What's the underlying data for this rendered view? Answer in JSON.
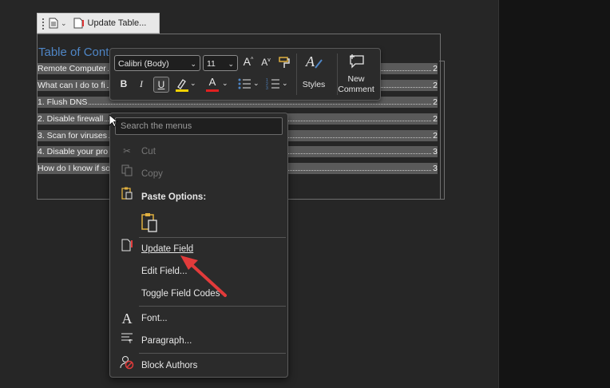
{
  "field_bar": {
    "update_label": "Update Table..."
  },
  "toc": {
    "title": "Table of Cont",
    "entries": [
      {
        "text": "Remote Computer",
        "page": "2"
      },
      {
        "text": "What can I do to fi",
        "page": "2"
      },
      {
        "text": "1. Flush DNS",
        "page": "2"
      },
      {
        "text": "2. Disable firewall",
        "page": "2"
      },
      {
        "text": "3. Scan for viruses",
        "page": "2"
      },
      {
        "text": "4. Disable your pro",
        "page": "3"
      },
      {
        "text": "How do I know if so",
        "page": "3"
      }
    ]
  },
  "mini_toolbar": {
    "font_name": "Calibri (Body)",
    "font_size": "11",
    "grow_font": "A",
    "shrink_font": "A",
    "bold": "B",
    "italic": "I",
    "underline": "U",
    "font_color": "A",
    "styles_label": "Styles",
    "new_comment_line1": "New",
    "new_comment_line2": "Comment",
    "highlight_color": "#f2d200",
    "font_color_value": "#e02020"
  },
  "context_menu": {
    "search_placeholder": "Search the menus",
    "cut": "Cut",
    "copy": "Copy",
    "paste_options": "Paste Options:",
    "update_field": "Update Field",
    "edit_field": "Edit Field...",
    "toggle_field_codes": "Toggle Field Codes",
    "font": "Font...",
    "paragraph": "Paragraph...",
    "block_authors": "Block Authors"
  },
  "colors": {
    "accent": "#4f86c6",
    "annotation_arrow": "#e23b3b"
  }
}
